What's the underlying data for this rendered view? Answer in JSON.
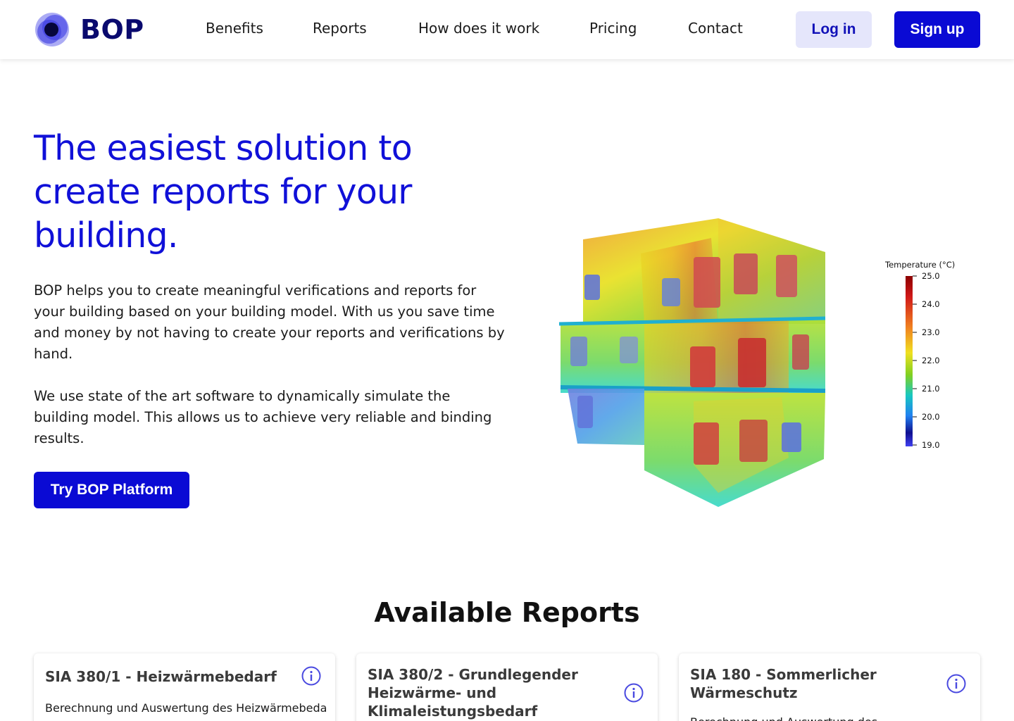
{
  "brand": {
    "name": "BOP"
  },
  "nav": {
    "items": [
      {
        "label": "Benefits"
      },
      {
        "label": "Reports"
      },
      {
        "label": "How does it work"
      },
      {
        "label": "Pricing"
      },
      {
        "label": "Contact"
      }
    ],
    "login_label": "Log in",
    "signup_label": "Sign up"
  },
  "hero": {
    "title_lines": [
      "The easiest solution to",
      "create reports for your",
      "building."
    ],
    "paragraph1": "BOP helps you to create meaningful verifications and reports for your building based on your building model. With us you save time and money by not having to create your reports and verifications by hand.",
    "paragraph2": "We use state of the art software to dynamically simulate the building model. This allows us to achieve very reliable and binding results.",
    "cta_label": "Try BOP Platform"
  },
  "visualization": {
    "legend_title": "Temperature (°C)",
    "legend_ticks": [
      "25.0",
      "24.0",
      "23.0",
      "22.0",
      "21.0",
      "20.0",
      "19.0"
    ]
  },
  "reports": {
    "title": "Available Reports",
    "cards": [
      {
        "title": "SIA 380/1 - Heizwärmebedarf",
        "description": "Berechnung und Auswertung des Heizwärmebedarfs"
      },
      {
        "title": "SIA 380/2 - Grundlegender Heizwärme- und Klimaleistungsbedarf",
        "description": ""
      },
      {
        "title": "SIA 180 - Sommerlicher Wärmeschutz",
        "description": "Berechnung und Auswertung des"
      }
    ]
  },
  "colors": {
    "primary": "#0a0ad4",
    "title_blue": "#1010d8",
    "login_bg": "#e5e6fb",
    "brand_dark": "#0a0a6e"
  }
}
